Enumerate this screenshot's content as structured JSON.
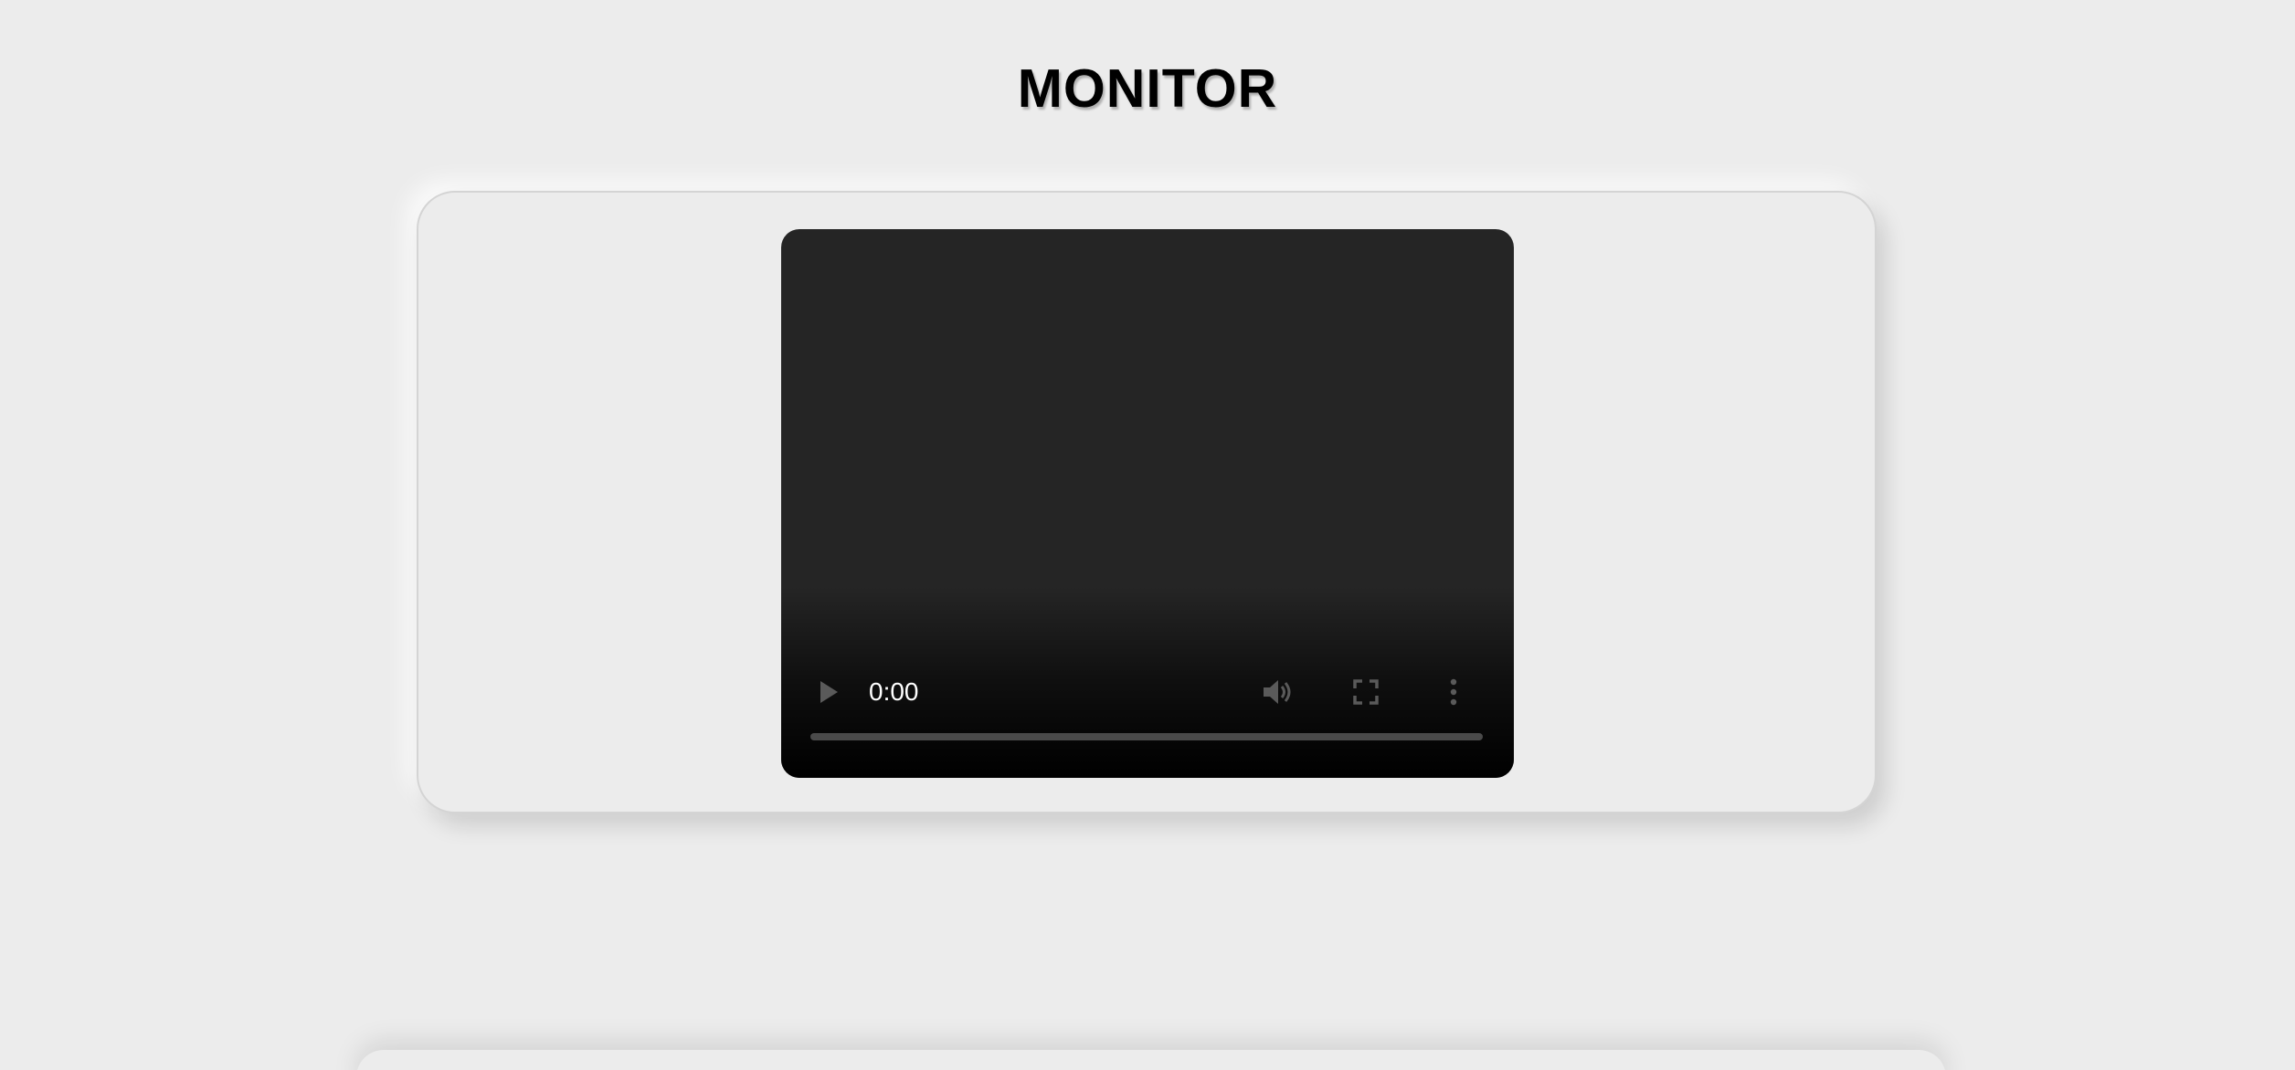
{
  "page": {
    "title": "MONITOR"
  },
  "video_player": {
    "time": "0:00",
    "progress": 0,
    "controls": {
      "play": "play-icon",
      "volume": "volume-icon",
      "fullscreen": "fullscreen-icon",
      "more": "more-vertical-icon"
    }
  },
  "colors": {
    "background": "#ececec",
    "video_surface": "#252525",
    "control_icon": "#5a5a5a",
    "time_text": "#ffffff"
  }
}
